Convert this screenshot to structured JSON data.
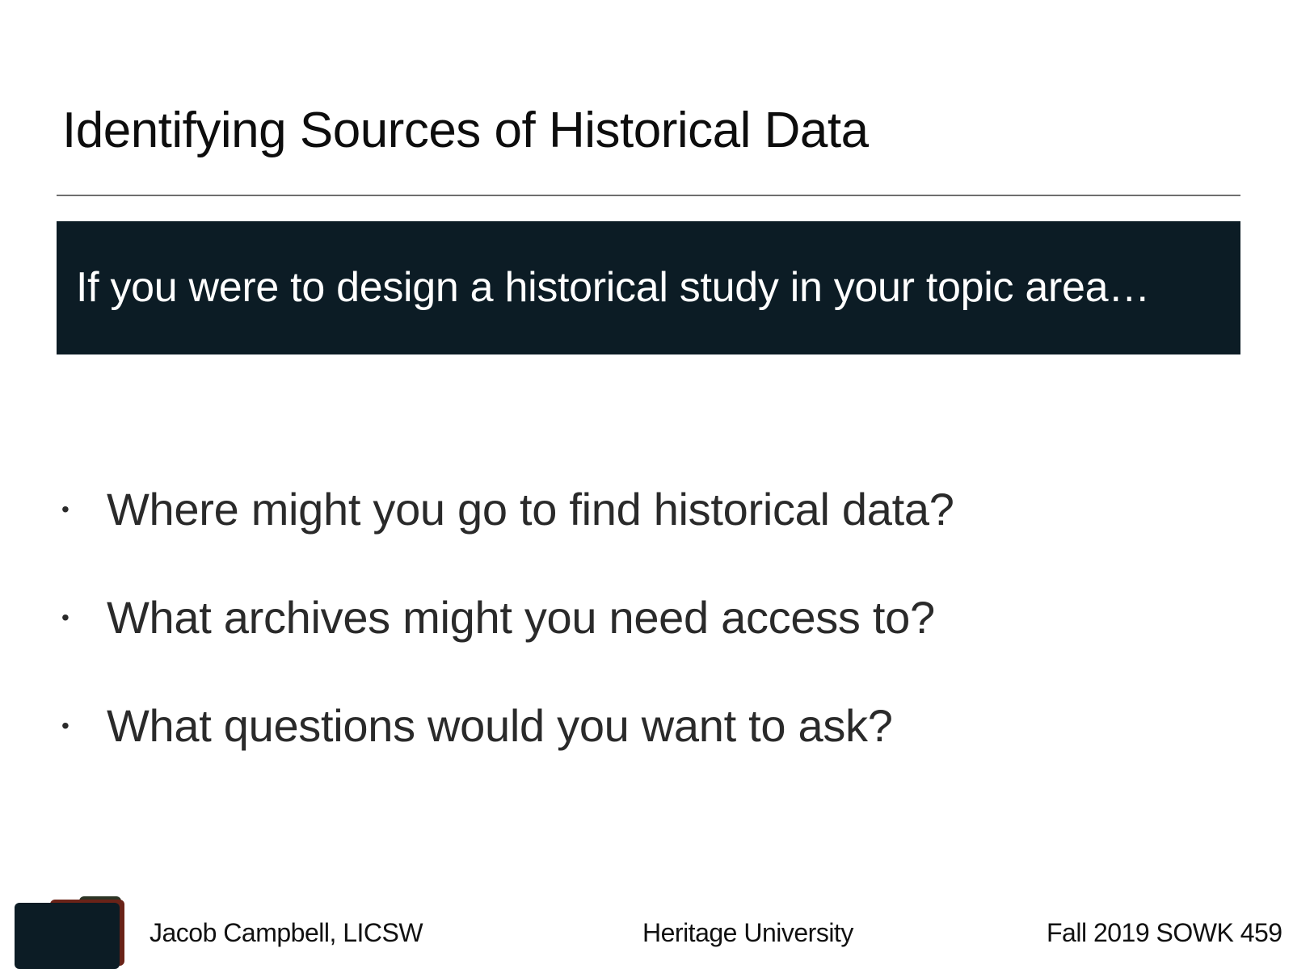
{
  "slide": {
    "title": "Identifying Sources of Historical Data",
    "banner": {
      "text": "If you were to design a historical study in your topic area…",
      "color": "#0c1c25"
    },
    "bullets": [
      {
        "symbol": "•",
        "text": "Where might you go to find historical data?"
      },
      {
        "symbol": "•",
        "text": "What archives might you need access to?"
      },
      {
        "symbol": "•",
        "text": "What questions would you want to ask?"
      }
    ],
    "footer": {
      "left": "Jacob Campbell, LICSW",
      "center": "Heritage University",
      "right": "Fall 2019 SOWK 459"
    }
  }
}
